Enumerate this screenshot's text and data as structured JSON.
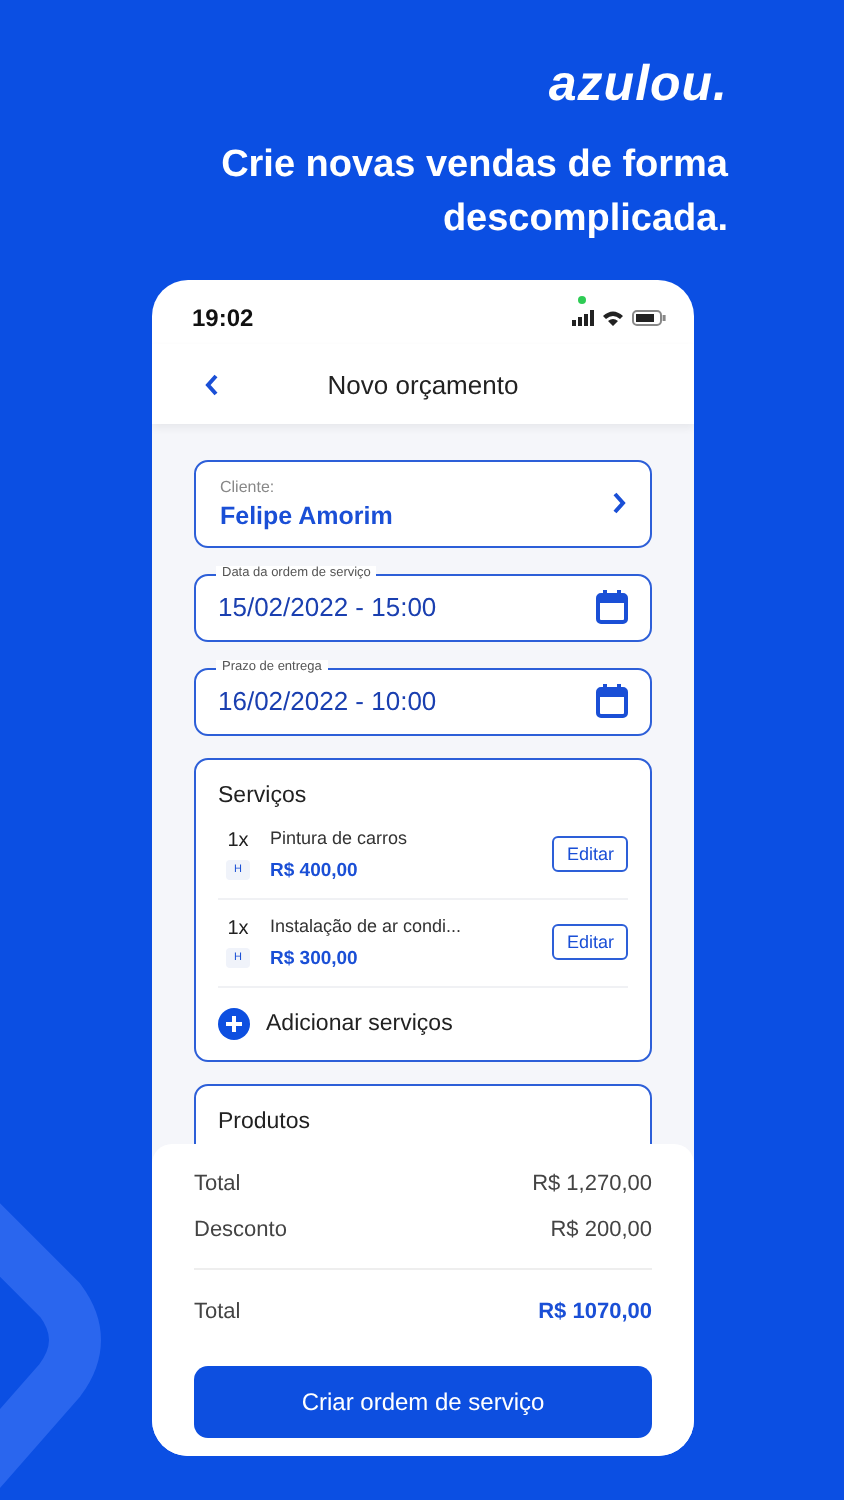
{
  "brand": "azulou.",
  "tagline": "Crie novas vendas de forma descomplicada.",
  "phone": {
    "status_time": "19:02",
    "nav_title": "Novo orçamento",
    "client": {
      "label": "Cliente:",
      "value": "Felipe Amorim"
    },
    "date_fields": [
      {
        "label": "Data da ordem de serviço",
        "value": "15/02/2022 - 15:00"
      },
      {
        "label": "Prazo de entrega",
        "value": "16/02/2022 - 10:00"
      }
    ],
    "services": {
      "title": "Serviços",
      "items": [
        {
          "qty": "1x",
          "badge": "H",
          "name": "Pintura de carros",
          "price": "R$ 400,00",
          "button": "Editar"
        },
        {
          "qty": "1x",
          "badge": "H",
          "name": "Instalação de ar condi...",
          "price": "R$ 300,00",
          "button": "Editar"
        }
      ],
      "add_label": "Adicionar serviços"
    },
    "products": {
      "title": "Produtos"
    },
    "summary": [
      {
        "kind": "plain",
        "label": "Total",
        "value": "R$ 1,270,00"
      },
      {
        "kind": "plain",
        "label": "Desconto",
        "value": "R$ 200,00"
      },
      {
        "kind": "grand",
        "label": "Total",
        "value": "R$ 1070,00"
      }
    ],
    "primary_button": "Criar ordem de serviço"
  }
}
